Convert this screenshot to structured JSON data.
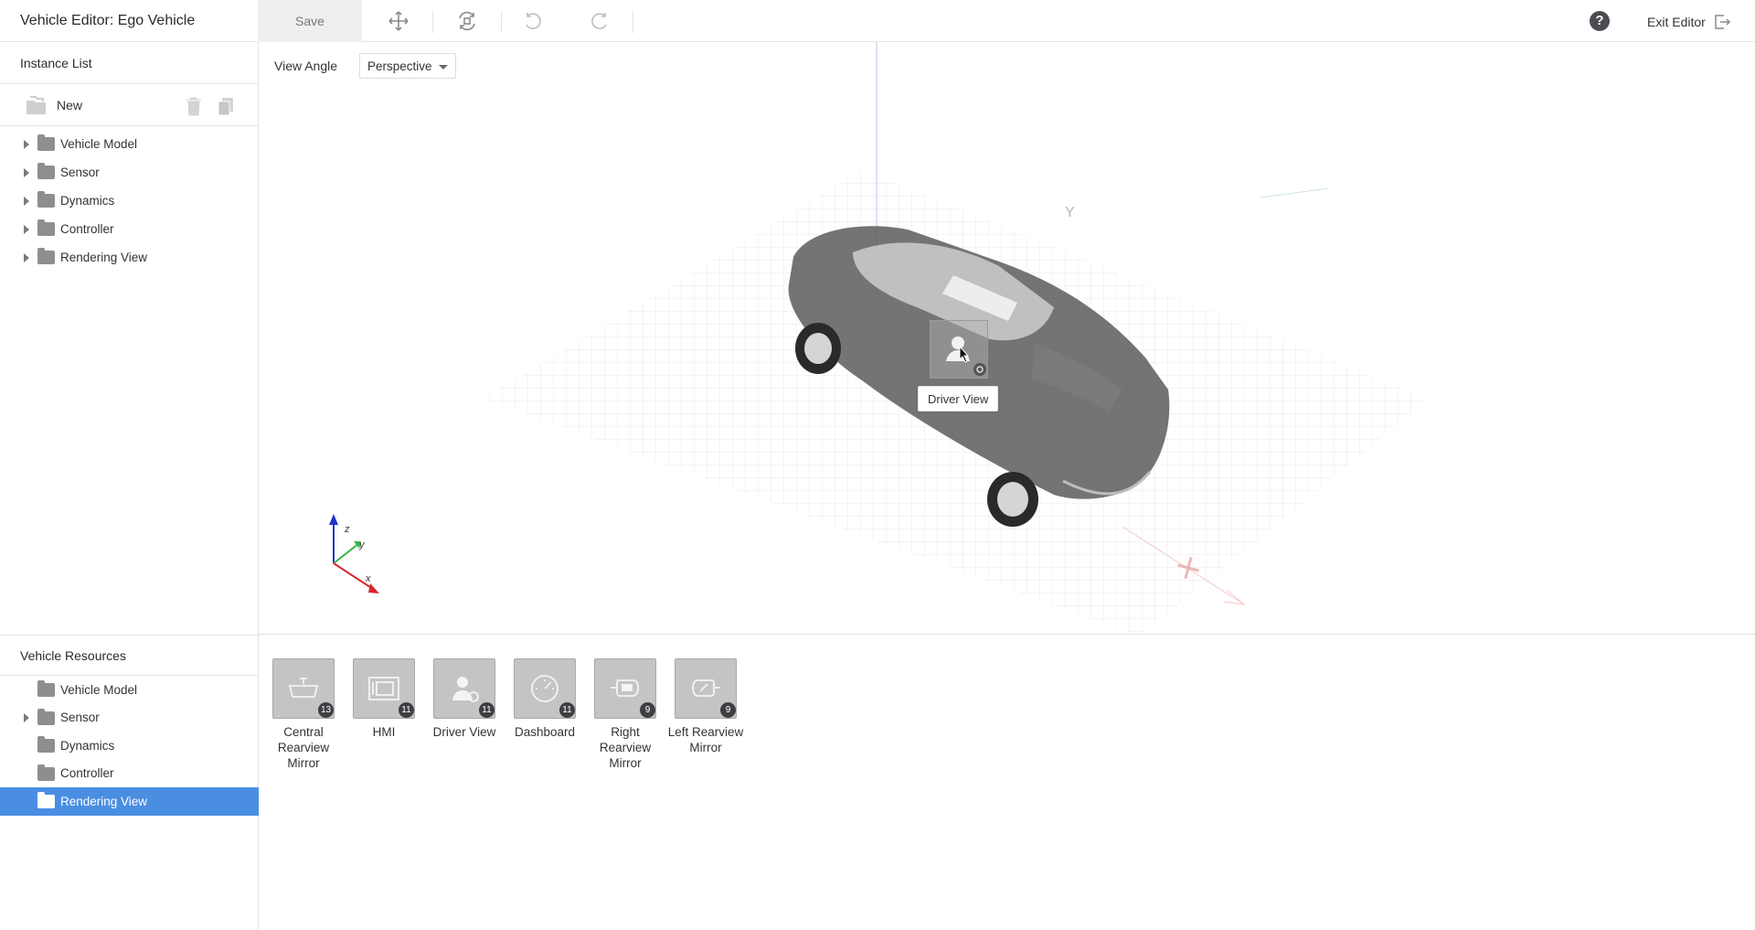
{
  "header": {
    "title": "Vehicle Editor: Ego Vehicle",
    "save_label": "Save",
    "help_label": "?",
    "exit_label": "Exit Editor"
  },
  "instance_list": {
    "title": "Instance List",
    "new_label": "New",
    "items": [
      {
        "label": "Vehicle Model"
      },
      {
        "label": "Sensor"
      },
      {
        "label": "Dynamics"
      },
      {
        "label": "Controller"
      },
      {
        "label": "Rendering View"
      }
    ]
  },
  "viewport": {
    "view_angle_label": "View Angle",
    "view_angle_value": "Perspective",
    "tooltip": "Driver View",
    "axis_z": "z",
    "axis_y": "y",
    "axis_x": "x",
    "scene_axis_y": "Y"
  },
  "vehicle_resources": {
    "title": "Vehicle Resources",
    "items": [
      {
        "label": "Vehicle Model",
        "expandable": false
      },
      {
        "label": "Sensor",
        "expandable": true
      },
      {
        "label": "Dynamics",
        "expandable": false
      },
      {
        "label": "Controller",
        "expandable": false
      },
      {
        "label": "Rendering View",
        "expandable": false,
        "selected": true
      }
    ]
  },
  "resources": [
    {
      "label": "Central Rearview Mirror",
      "count": "13",
      "icon": "rearview-mirror-icon"
    },
    {
      "label": "HMI",
      "count": "11",
      "icon": "hmi-icon"
    },
    {
      "label": "Driver View",
      "count": "11",
      "icon": "driver-view-icon"
    },
    {
      "label": "Dashboard",
      "count": "11",
      "icon": "dashboard-icon"
    },
    {
      "label": "Right Rearview Mirror",
      "count": "9",
      "icon": "right-mirror-icon"
    },
    {
      "label": "Left Rearview Mirror",
      "count": "9",
      "icon": "left-mirror-icon"
    }
  ],
  "colors": {
    "selection": "#4a8ee2",
    "axis_x": "#d9262b",
    "axis_y": "#3bb34a",
    "axis_z": "#1f35c9"
  }
}
